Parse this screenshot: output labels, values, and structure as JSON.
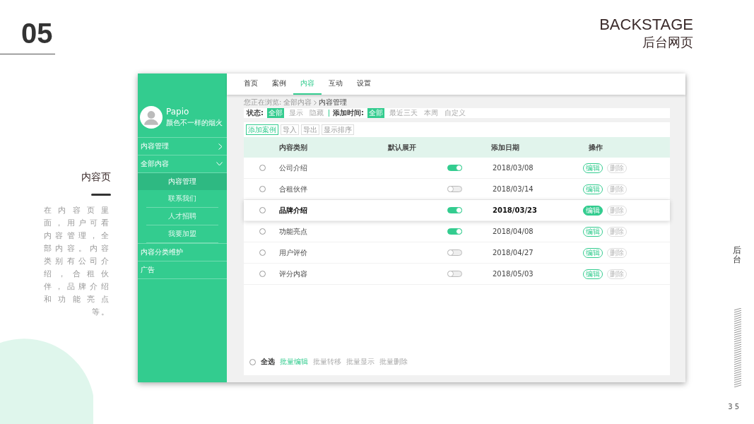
{
  "slide": {
    "number": "05",
    "title_en": "BACKSTAGE",
    "title_cn": "后台网页",
    "section_title": "内容页",
    "description": "在内容页里面，用户可看内容管理，全部内容。内容类别有公司介绍，合租伙伴，品牌介绍和功能亮点等。",
    "side_label": "后台",
    "page_number": "35"
  },
  "profile": {
    "name": "Papio",
    "tagline": "颜色不一样的烟火"
  },
  "sidebar": [
    {
      "label": "内容管理",
      "kind": "group",
      "expanded": false
    },
    {
      "label": "全部内容",
      "kind": "group",
      "expanded": true,
      "children": [
        {
          "label": "内容管理",
          "selected": true
        },
        {
          "label": "联系我们",
          "selected": false
        },
        {
          "label": "人才招聘",
          "selected": false
        },
        {
          "label": "我要加盟",
          "selected": false
        }
      ]
    },
    {
      "label": "内容分类维护",
      "kind": "plain"
    },
    {
      "label": "广告",
      "kind": "plain"
    }
  ],
  "tabs": [
    {
      "label": "首页",
      "selected": false
    },
    {
      "label": "案例",
      "selected": false
    },
    {
      "label": "内容",
      "selected": true
    },
    {
      "label": "互动",
      "selected": false
    },
    {
      "label": "设置",
      "selected": false
    }
  ],
  "breadcrumb": {
    "label": "您正在浏览:",
    "items": [
      "全部内容",
      "内容管理"
    ]
  },
  "filters": [
    {
      "label": "状态:",
      "options": [
        {
          "label": "全部",
          "selected": true
        },
        {
          "label": "显示",
          "selected": false
        },
        {
          "label": "隐藏",
          "selected": false
        }
      ]
    },
    {
      "label": "添加时间:",
      "options": [
        {
          "label": "全部",
          "selected": true
        },
        {
          "label": "最近三天",
          "selected": false
        },
        {
          "label": "本周",
          "selected": false
        },
        {
          "label": "自定义",
          "selected": false
        }
      ]
    }
  ],
  "toolbar": [
    {
      "label": "添加案例",
      "primary": true
    },
    {
      "label": "导入",
      "primary": false
    },
    {
      "label": "导出",
      "primary": false
    },
    {
      "label": "显示排序",
      "primary": false
    }
  ],
  "table": {
    "columns": [
      "内容类别",
      "默认展开",
      "添加日期",
      "操作"
    ],
    "rows": [
      {
        "checked": false,
        "category": "公司介绍",
        "expanded": true,
        "date": "2018/03/08",
        "selected": false,
        "actions": [
          "编辑",
          "删除"
        ]
      },
      {
        "checked": false,
        "category": "合租伙伴",
        "expanded": false,
        "date": "2018/03/14",
        "selected": false,
        "actions": [
          "编辑",
          "删除"
        ]
      },
      {
        "checked": false,
        "category": "品牌介绍",
        "expanded": true,
        "date": "2018/03/23",
        "selected": true,
        "actions": [
          "编辑",
          "删除"
        ]
      },
      {
        "checked": false,
        "category": "功能亮点",
        "expanded": true,
        "date": "2018/04/08",
        "selected": false,
        "actions": [
          "编辑",
          "删除"
        ]
      },
      {
        "checked": false,
        "category": "用户评价",
        "expanded": false,
        "date": "2018/04/27",
        "selected": false,
        "actions": [
          "编辑",
          "删除"
        ]
      },
      {
        "checked": false,
        "category": "评分内容",
        "expanded": false,
        "date": "2018/05/03",
        "selected": false,
        "actions": [
          "编辑",
          "删除"
        ]
      }
    ]
  },
  "bulk_bar": {
    "select_all": {
      "label": "全选",
      "checked": false
    },
    "actions": [
      {
        "label": "批量编辑",
        "primary": true
      },
      {
        "label": "批量转移",
        "primary": false
      },
      {
        "label": "批量显示",
        "primary": false
      },
      {
        "label": "批量删除",
        "primary": false
      }
    ]
  }
}
